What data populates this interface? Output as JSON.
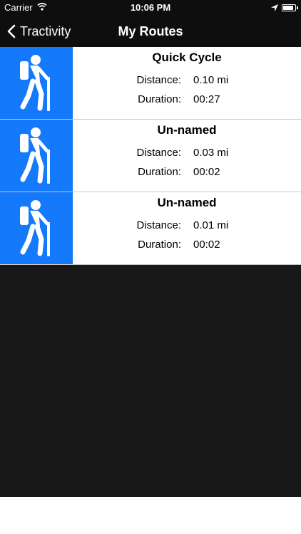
{
  "status_bar": {
    "carrier": "Carrier",
    "time": "10:06 PM",
    "battery_level": 0.9
  },
  "nav": {
    "back_label": "Tractivity",
    "title": "My Routes"
  },
  "routes": [
    {
      "name": "Quick Cycle",
      "distance_label": "Distance:",
      "distance": "0.10 mi",
      "duration_label": "Duration:",
      "duration": "00:27",
      "icon": "hiker-icon"
    },
    {
      "name": "Un-named",
      "distance_label": "Distance:",
      "distance": "0.03 mi",
      "duration_label": "Duration:",
      "duration": "00:02",
      "icon": "hiker-icon"
    },
    {
      "name": "Un-named",
      "distance_label": "Distance:",
      "distance": "0.01 mi",
      "duration_label": "Duration:",
      "duration": "00:02",
      "icon": "hiker-icon"
    }
  ],
  "colors": {
    "accent": "#1479fa",
    "bar_background": "#0e0e0e",
    "empty_area": "#181818"
  }
}
